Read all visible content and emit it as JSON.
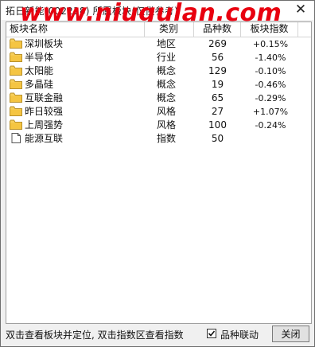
{
  "window": {
    "title": "拓日新能(002218)  所属板块(仅供参考)",
    "watermark": "www.niugulan.com"
  },
  "table": {
    "columns": [
      "板块名称",
      "类别",
      "品种数",
      "板块指数"
    ],
    "rows": [
      {
        "name": "深圳板块",
        "category": "地区",
        "count": "269",
        "index": "+0.15%",
        "icon": "folder-icon"
      },
      {
        "name": "半导体",
        "category": "行业",
        "count": "56",
        "index": "-1.40%",
        "icon": "folder-icon"
      },
      {
        "name": "太阳能",
        "category": "概念",
        "count": "129",
        "index": "-0.10%",
        "icon": "folder-icon"
      },
      {
        "name": "多晶硅",
        "category": "概念",
        "count": "19",
        "index": "-0.46%",
        "icon": "folder-icon"
      },
      {
        "name": "互联金融",
        "category": "概念",
        "count": "65",
        "index": "-0.29%",
        "icon": "folder-icon"
      },
      {
        "name": "昨日较强",
        "category": "风格",
        "count": "27",
        "index": "+1.07%",
        "icon": "folder-icon"
      },
      {
        "name": "上周强势",
        "category": "风格",
        "count": "100",
        "index": "-0.24%",
        "icon": "folder-icon"
      },
      {
        "name": "能源互联",
        "category": "指数",
        "count": "50",
        "index": "",
        "icon": "document-icon"
      }
    ]
  },
  "footer": {
    "hint": "双击查看板块并定位, 双击指数区查看指数",
    "checkbox_label": "品种联动",
    "checkbox_checked": true,
    "close_label": "关闭"
  },
  "colors": {
    "watermark": "#e8000f",
    "folder": "#f5c542"
  }
}
